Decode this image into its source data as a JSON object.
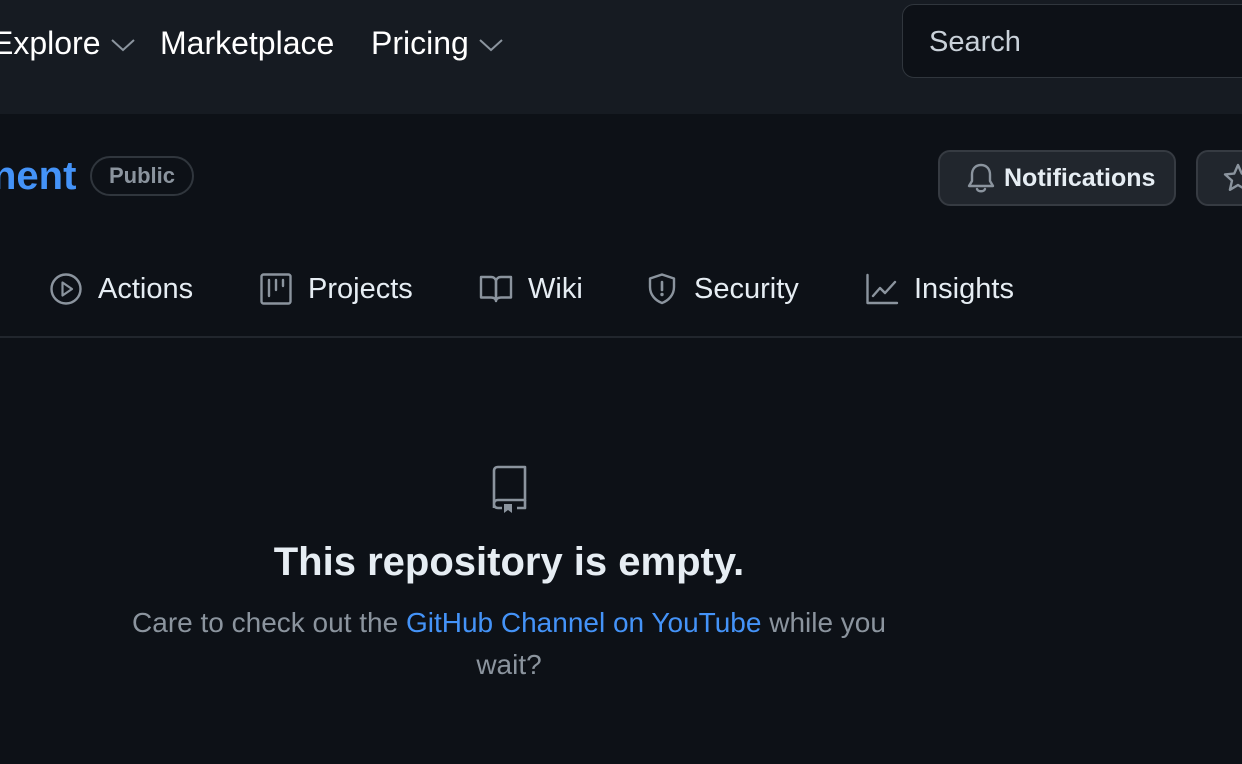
{
  "header": {
    "nav": [
      {
        "label": "Explore",
        "has_dropdown": true
      },
      {
        "label": "Marketplace",
        "has_dropdown": false
      },
      {
        "label": "Pricing",
        "has_dropdown": true
      }
    ],
    "search": {
      "placeholder": "Search"
    }
  },
  "repo": {
    "name_visible": "nent",
    "visibility_badge": "Public",
    "notifications_label": "Notifications"
  },
  "tabs": [
    {
      "label": "Actions",
      "icon": "play-icon"
    },
    {
      "label": "Projects",
      "icon": "project-icon"
    },
    {
      "label": "Wiki",
      "icon": "book-icon"
    },
    {
      "label": "Security",
      "icon": "shield-icon"
    },
    {
      "label": "Insights",
      "icon": "graph-icon"
    }
  ],
  "empty_state": {
    "title": "This repository is empty.",
    "text_before": "Care to check out the ",
    "link_text": "GitHub Channel on YouTube",
    "text_after": " while you wait?"
  },
  "colors": {
    "background": "#0d1117",
    "header_background": "#161b22",
    "link": "#4493f8",
    "muted_text": "#8b949e"
  }
}
